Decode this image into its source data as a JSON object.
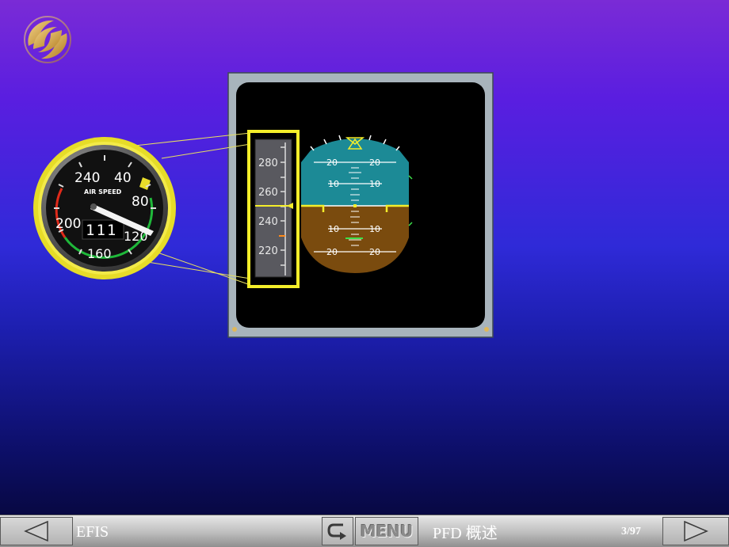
{
  "airspeed_gauge": {
    "label": "AIR SPEED",
    "scale": [
      "240",
      "40",
      "80",
      "120",
      "160",
      "200"
    ],
    "readout": "111"
  },
  "speed_tape": {
    "scale": [
      "280",
      "260",
      "240",
      "220"
    ]
  },
  "attitude_indicator": {
    "pitch_upper": [
      "20",
      "20",
      "10",
      "10"
    ],
    "pitch_lower": [
      "10",
      "10",
      "20",
      "20"
    ]
  },
  "navbar": {
    "section": "EFIS",
    "menu_label": "MENU",
    "page_title": "PFD 概述",
    "page_number": "3/97"
  }
}
